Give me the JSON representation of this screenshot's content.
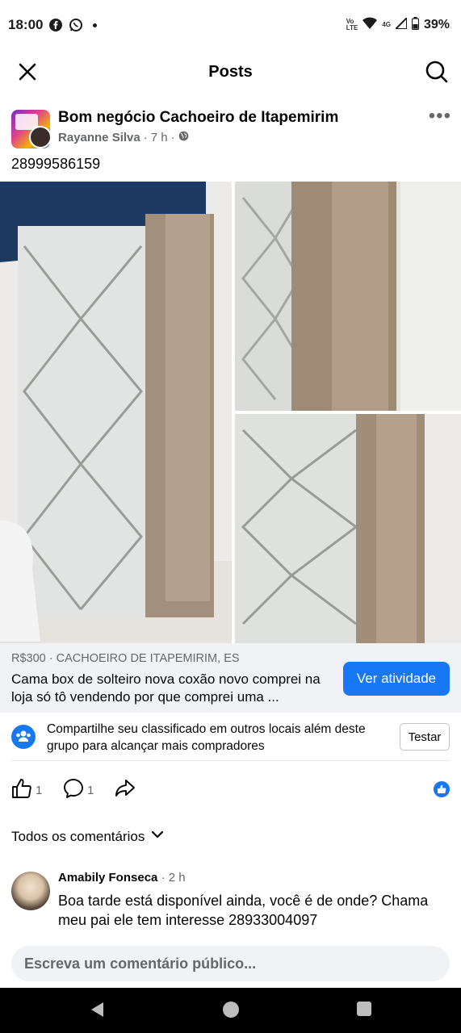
{
  "status_bar": {
    "time": "18:00",
    "network": "4G",
    "battery": "39%"
  },
  "top_bar": {
    "title": "Posts",
    "close_icon": "close-icon",
    "search_icon": "search-icon"
  },
  "post": {
    "group_name": "Bom negócio Cachoeiro de Itapemirim",
    "author": "Rayanne Silva",
    "time": "7 h",
    "text": "28999586159"
  },
  "listing": {
    "price_location": "R$300 · CACHOEIRO DE ITAPEMIRIM, ES",
    "description": "Cama box de solteiro nova coxão novo comprei na loja só tô vendendo por que comprei uma ...",
    "activity_button": "Ver atividade"
  },
  "share_banner": {
    "text": "Compartilhe seu classificado em outros locais além deste grupo para alcançar mais compradores",
    "button": "Testar"
  },
  "actions": {
    "likes": "1",
    "comments": "1"
  },
  "comments_section": {
    "filter_label": "Todos os comentários",
    "items": [
      {
        "author": "Amabily Fonseca",
        "time": "2 h",
        "text": "Boa tarde está disponível ainda, você é de onde? Chama meu pai ele tem interesse 28933004097"
      }
    ]
  },
  "comment_input": {
    "placeholder": "Escreva um comentário público..."
  },
  "colors": {
    "accent": "#1877f2",
    "secondary_text": "#65676b",
    "listing_bg": "#f0f2f5"
  }
}
